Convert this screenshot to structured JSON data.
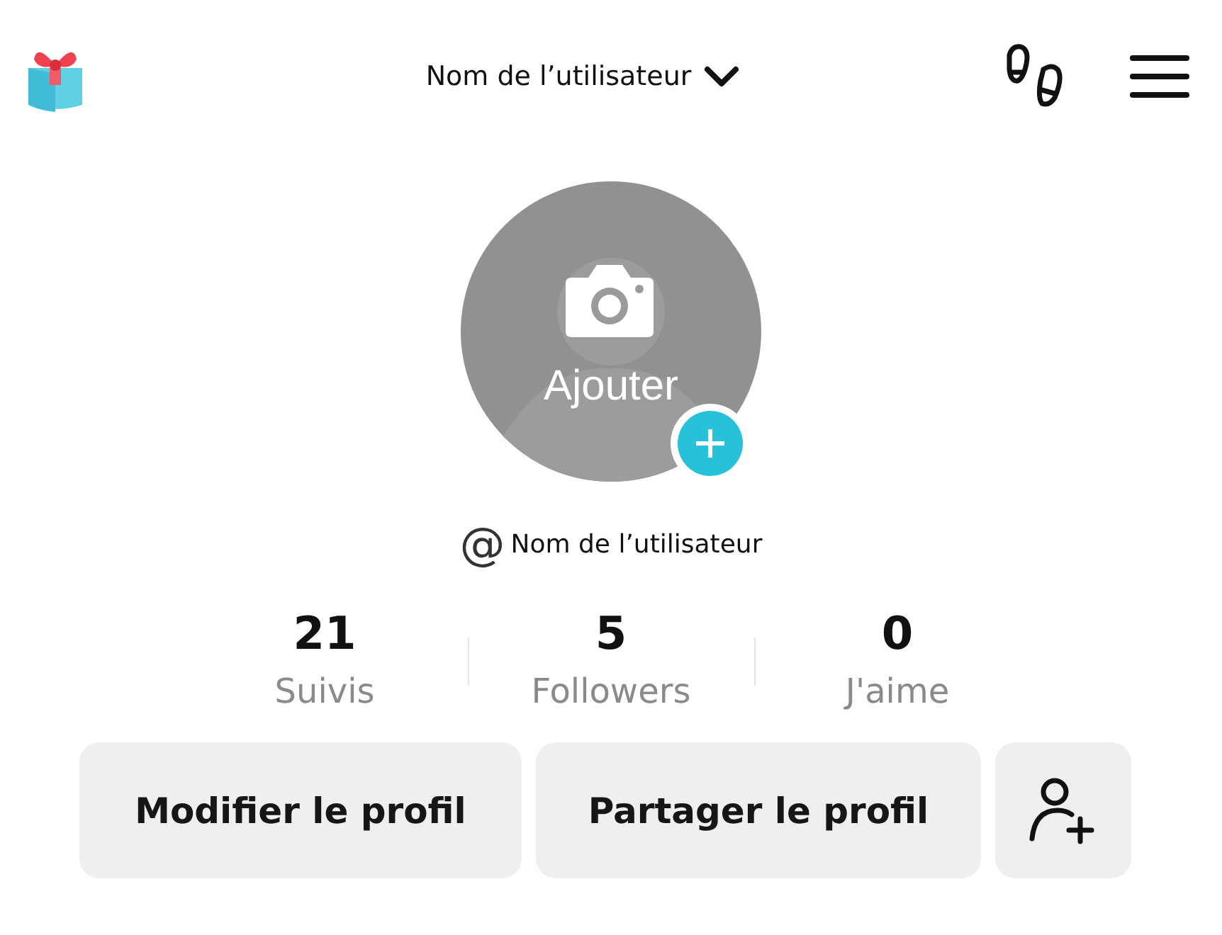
{
  "header": {
    "title": "Nom de l’utilisateur"
  },
  "avatar": {
    "label": "Ajouter"
  },
  "handle": {
    "at": "@",
    "name": "Nom de l’utilisateur"
  },
  "stats": [
    {
      "value": "21",
      "label": "Suivis"
    },
    {
      "value": "5",
      "label": "Followers"
    },
    {
      "value": "0",
      "label": "J'aime"
    }
  ],
  "buttons": [
    "Modifier le profil",
    "Partager le profil"
  ]
}
